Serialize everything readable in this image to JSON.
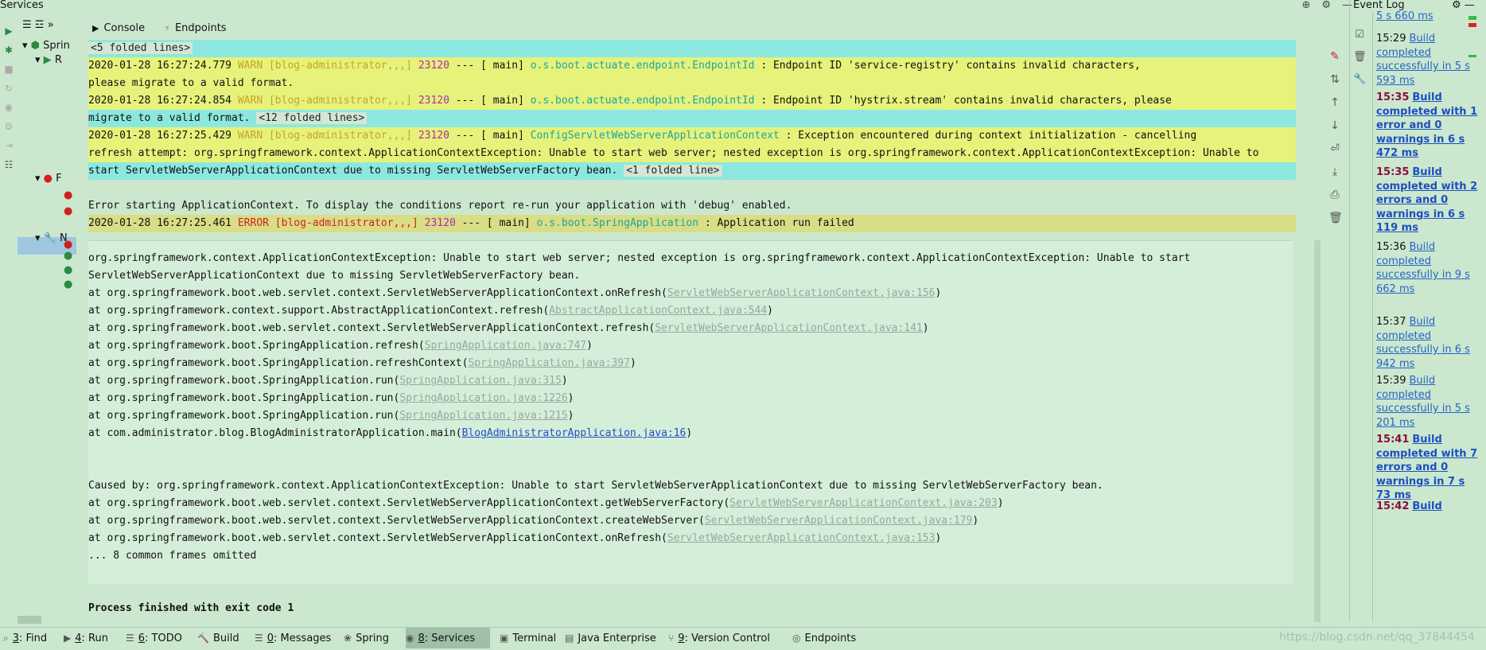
{
  "services": {
    "title": "Services",
    "tree": [
      "Sprin",
      "R",
      "F",
      "N"
    ]
  },
  "console_tabs": [
    {
      "label": "Console",
      "icon": "console-icon"
    },
    {
      "label": "Endpoints",
      "icon": "endpoints-icon"
    }
  ],
  "console": {
    "folded_5": "<5 folded lines>",
    "l1_ts": "2020-01-28 16:27:24.779",
    "l1_lvl": "WARN",
    "l1_app": "[blog-administrator,,,]",
    "l1_pid": "23120",
    "l1_sep": "--- [",
    "l1_thread": "main]",
    "l1_logger": "o.s.boot.actuate.endpoint.EndpointId",
    "l1_msg": ": Endpoint ID 'service-registry' contains invalid characters,",
    "l1_cont": "please migrate to a valid format.",
    "l2_ts": "2020-01-28 16:27:24.854",
    "l2_lvl": "WARN",
    "l2_app": "[blog-administrator,,,]",
    "l2_pid": "23120",
    "l2_sep": "--- [",
    "l2_thread": "main]",
    "l2_logger": "o.s.boot.actuate.endpoint.EndpointId",
    "l2_msg": ": Endpoint ID 'hystrix.stream' contains invalid characters, please",
    "l2_cont": "migrate to a valid format.",
    "folded_12": "<12 folded lines>",
    "l3_ts": "2020-01-28 16:27:25.429",
    "l3_lvl": "WARN",
    "l3_app": "[blog-administrator,,,]",
    "l3_pid": "23120",
    "l3_sep": "--- [",
    "l3_thread": "main]",
    "l3_logger": "ConfigServletWebServerApplicationContext",
    "l3_msg": ": Exception encountered during context initialization - cancelling",
    "l3_cont1": "refresh attempt: org.springframework.context.ApplicationContextException: Unable to start web server; nested exception is org.springframework.context.ApplicationContextException: Unable to",
    "l3_cont2": "start ServletWebServerApplicationContext due to missing ServletWebServerFactory bean.",
    "folded_1": "<1 folded line>",
    "err_ctx": "Error starting ApplicationContext. To display the conditions report re-run your application with 'debug' enabled.",
    "l4_ts": "2020-01-28 16:27:25.461",
    "l4_lvl": "ERROR",
    "l4_app": "[blog-administrator,,,]",
    "l4_pid": "23120",
    "l4_sep": "--- [",
    "l4_thread": "main]",
    "l4_logger": "o.s.boot.SpringApplication",
    "l4_msg": ": Application run failed",
    "exc1": "org.springframework.context.ApplicationContextException: Unable to start web server; nested exception is org.springframework.context.ApplicationContextException: Unable to start",
    "exc2": "ServletWebServerApplicationContext due to missing ServletWebServerFactory bean.",
    "stack": [
      {
        "at": "at org.springframework.boot.web.servlet.context.ServletWebServerApplicationContext.onRefresh(",
        "link": "ServletWebServerApplicationContext.java:156",
        "end": ")"
      },
      {
        "at": "at org.springframework.context.support.AbstractApplicationContext.refresh(",
        "link": "AbstractApplicationContext.java:544",
        "end": ")"
      },
      {
        "at": "at org.springframework.boot.web.servlet.context.ServletWebServerApplicationContext.refresh(",
        "link": "ServletWebServerApplicationContext.java:141",
        "end": ")"
      },
      {
        "at": "at org.springframework.boot.SpringApplication.refresh(",
        "link": "SpringApplication.java:747",
        "end": ")"
      },
      {
        "at": "at org.springframework.boot.SpringApplication.refreshContext(",
        "link": "SpringApplication.java:397",
        "end": ")"
      },
      {
        "at": "at org.springframework.boot.SpringApplication.run(",
        "link": "SpringApplication.java:315",
        "end": ")"
      },
      {
        "at": "at org.springframework.boot.SpringApplication.run(",
        "link": "SpringApplication.java:1226",
        "end": ")"
      },
      {
        "at": "at org.springframework.boot.SpringApplication.run(",
        "link": "SpringApplication.java:1215",
        "end": ")"
      },
      {
        "at": "at com.administrator.blog.BlogAdministratorApplication.main(",
        "link": "BlogAdministratorApplication.java:16",
        "end": ")"
      }
    ],
    "caused": "Caused by: org.springframework.context.ApplicationContextException: Unable to start ServletWebServerApplicationContext due to missing ServletWebServerFactory bean.",
    "stack2": [
      {
        "at": "at org.springframework.boot.web.servlet.context.ServletWebServerApplicationContext.getWebServerFactory(",
        "link": "ServletWebServerApplicationContext.java:203",
        "end": ")"
      },
      {
        "at": "at org.springframework.boot.web.servlet.context.ServletWebServerApplicationContext.createWebServer(",
        "link": "ServletWebServerApplicationContext.java:179",
        "end": ")"
      },
      {
        "at": "at org.springframework.boot.web.servlet.context.ServletWebServerApplicationContext.onRefresh(",
        "link": "ServletWebServerApplicationContext.java:153",
        "end": ")"
      }
    ],
    "omitted": "... 8 common frames omitted",
    "exit": "Process finished with exit code 1"
  },
  "event_log": {
    "title": "Event Log",
    "partial_top": "5 s 660 ms",
    "events": [
      {
        "time": "15:29",
        "text": "Build completed successfully in 5 s 593 ms",
        "bold": false
      },
      {
        "time": "15:35",
        "text": "Build completed with 1 error and 0 warnings in 6 s 472 ms",
        "bold": true
      },
      {
        "time": "15:35",
        "text": "Build completed with 2 errors and 0 warnings in 6 s 119 ms",
        "bold": true
      },
      {
        "time": "15:36",
        "text": "Build completed successfully in 9 s 662 ms",
        "bold": false
      },
      {
        "time": "15:37",
        "text": "Build completed successfully in 6 s 942 ms",
        "bold": false
      },
      {
        "time": "15:39",
        "text": "Build completed successfully in 5 s 201 ms",
        "bold": false
      },
      {
        "time": "15:41",
        "text": "Build completed with 7 errors and 0 warnings in 7 s 73 ms",
        "bold": true
      },
      {
        "time": "15:42",
        "text": "Build",
        "bold": true
      }
    ]
  },
  "bottom_tabs": [
    {
      "num": "3",
      "label": ": Find",
      "icon": "search-icon"
    },
    {
      "num": "4",
      "label": ": Run",
      "icon": "run-icon"
    },
    {
      "num": "6",
      "label": ": TODO",
      "icon": "todo-icon"
    },
    {
      "num": "",
      "label": "Build",
      "icon": "build-icon"
    },
    {
      "num": "0",
      "label": ": Messages",
      "icon": "messages-icon"
    },
    {
      "num": "",
      "label": "Spring",
      "icon": "spring-icon"
    },
    {
      "num": "8",
      "label": ": Services",
      "icon": "services-icon"
    },
    {
      "num": "",
      "label": "Terminal",
      "icon": "terminal-icon"
    },
    {
      "num": "",
      "label": "Java Enterprise",
      "icon": "java-enterprise-icon"
    },
    {
      "num": "9",
      "label": ": Version Control",
      "icon": "version-control-icon"
    },
    {
      "num": "",
      "label": "Endpoints",
      "icon": "endpoints-icon"
    }
  ],
  "watermark": "https://blog.csdn.net/qq_37844454",
  "colors": {
    "warn": "#c9a227",
    "error": "#d12020",
    "logger": "#1aa6a0",
    "pid": "#b32ba6",
    "bg": "#cbe8cf"
  }
}
